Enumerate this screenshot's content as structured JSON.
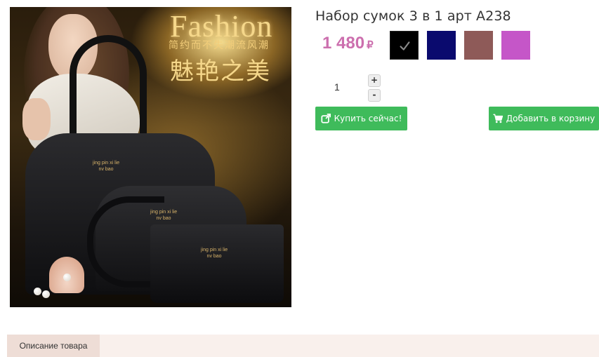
{
  "product": {
    "title": "Набор сумок 3 в 1 арт A238",
    "price": "1 480",
    "currency": "₽",
    "image": {
      "headline": "Fashion",
      "subline_cn": "简约而不失潮流风潮",
      "tagline_cn": "魅艳之美",
      "bag_brand_large": "jing pin xi lie\nnv bao",
      "bag_brand_medium": "jing pin xi lie\nnv bao",
      "bag_brand_small": "jing pin xi lie\nnv bao"
    }
  },
  "colors": {
    "accent_price": "#cc6fae",
    "button_green": "#3fbb5b",
    "swatches": [
      "#000000",
      "#0a0a6e",
      "#8e5a58",
      "#c556c8"
    ]
  },
  "swatch_selected_index": 0,
  "quantity": {
    "value": "1",
    "plus_label": "+",
    "minus_label": "-"
  },
  "actions": {
    "buy_now_label": "Купить сейчас!",
    "buy_now_icon": "external-link-icon",
    "add_to_cart_label": "Добавить в корзину",
    "add_to_cart_icon": "cart-icon"
  },
  "tabs": {
    "description_label": "Описание товара"
  }
}
